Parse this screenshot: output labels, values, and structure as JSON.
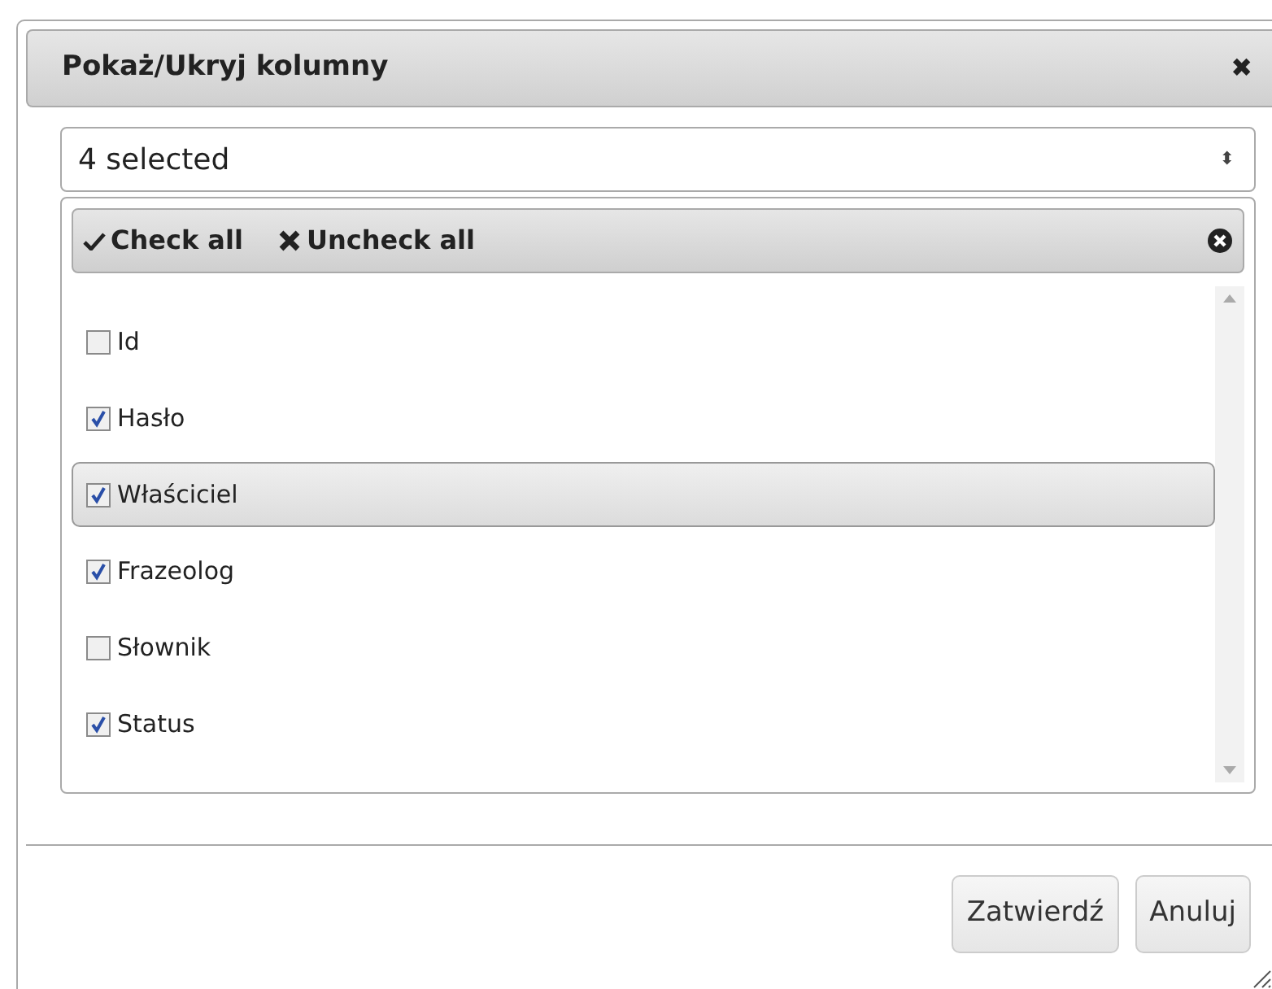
{
  "dialog": {
    "title": "Pokaż/Ukryj kolumny",
    "close": "✖"
  },
  "select": {
    "value": "4 selected",
    "arrow": "⬍"
  },
  "panel": {
    "check_all": "Check all",
    "uncheck_all": "Uncheck all",
    "items": [
      {
        "label": "Id",
        "checked": false,
        "hovered": false
      },
      {
        "label": "Hasło",
        "checked": true,
        "hovered": false
      },
      {
        "label": "Właściciel",
        "checked": true,
        "hovered": true
      },
      {
        "label": "Frazeolog",
        "checked": true,
        "hovered": false
      },
      {
        "label": "Słownik",
        "checked": false,
        "hovered": false
      },
      {
        "label": "Status",
        "checked": true,
        "hovered": false
      }
    ]
  },
  "buttons": [
    "Zatwierdź",
    "Anuluj"
  ]
}
